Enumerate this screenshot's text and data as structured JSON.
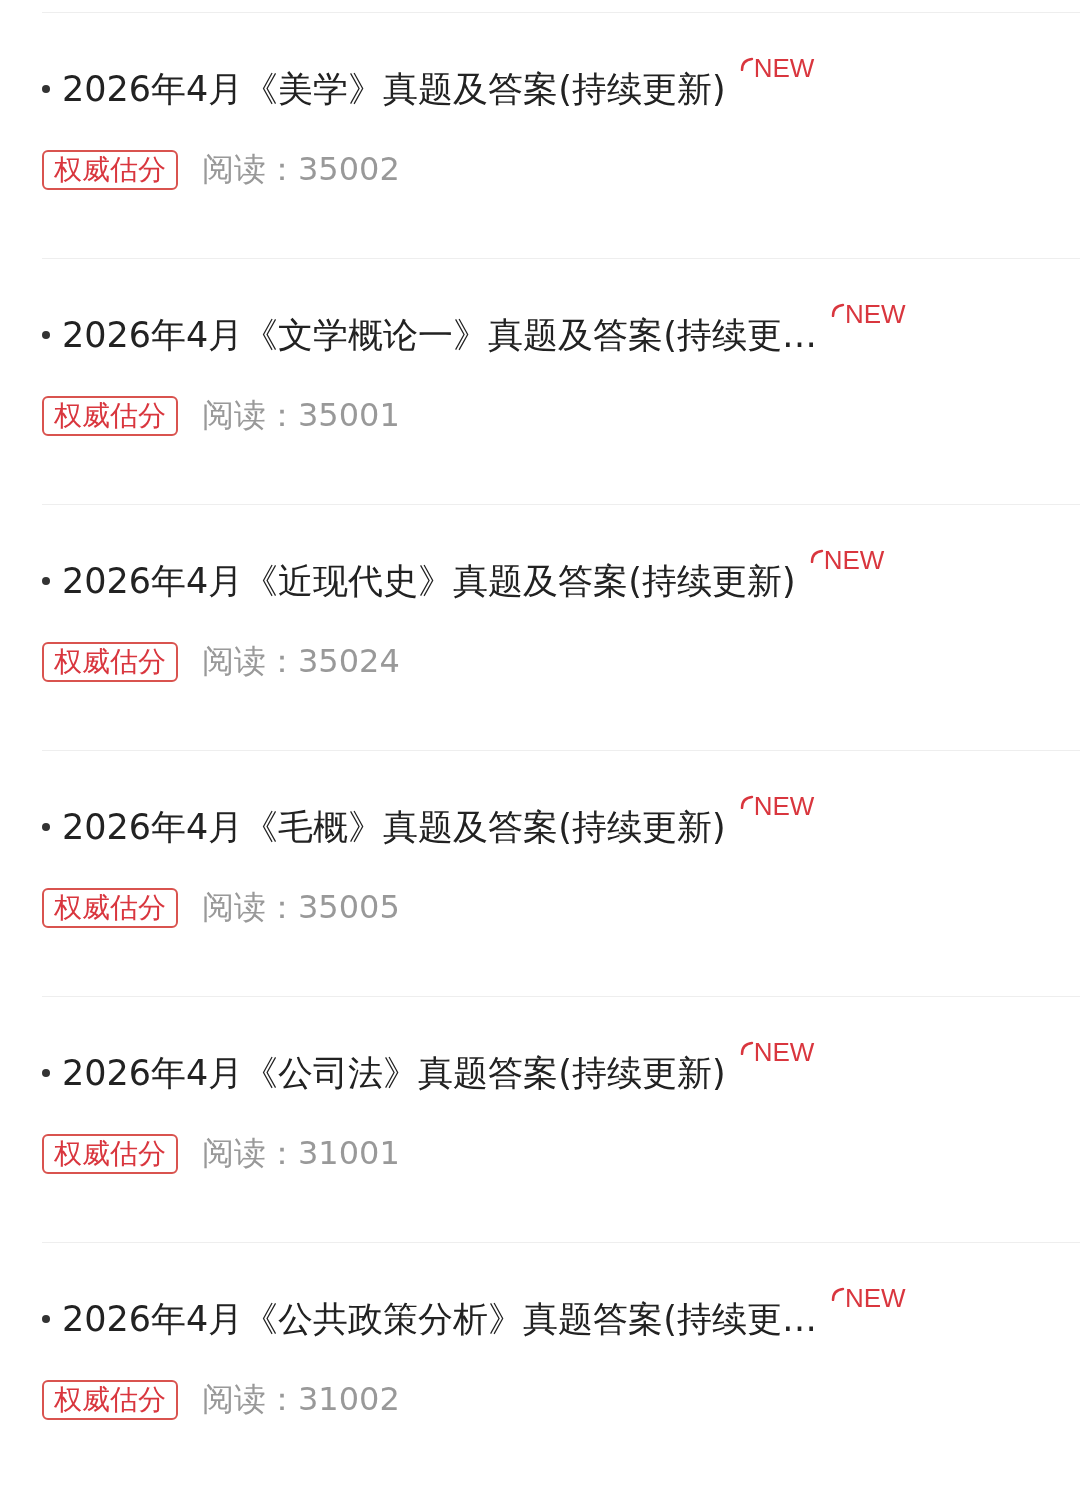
{
  "articles": [
    {
      "title": "2026年4月《美学》真题及答案(持续更新)",
      "badge": "NEW",
      "tag": "权威估分",
      "reads": "阅读：35002"
    },
    {
      "title": "2026年4月《文学概论一》真题及答案(持续更…",
      "badge": "NEW",
      "tag": "权威估分",
      "reads": "阅读：35001"
    },
    {
      "title": "2026年4月《近现代史》真题及答案(持续更新)",
      "badge": "NEW",
      "tag": "权威估分",
      "reads": "阅读：35024"
    },
    {
      "title": "2026年4月《毛概》真题及答案(持续更新)",
      "badge": "NEW",
      "tag": "权威估分",
      "reads": "阅读：35005"
    },
    {
      "title": "2026年4月《公司法》真题答案(持续更新)",
      "badge": "NEW",
      "tag": "权威估分",
      "reads": "阅读：31001"
    },
    {
      "title": "2026年4月《公共政策分析》真题答案(持续更…",
      "badge": "NEW",
      "tag": "权威估分",
      "reads": "阅读：31002"
    }
  ]
}
